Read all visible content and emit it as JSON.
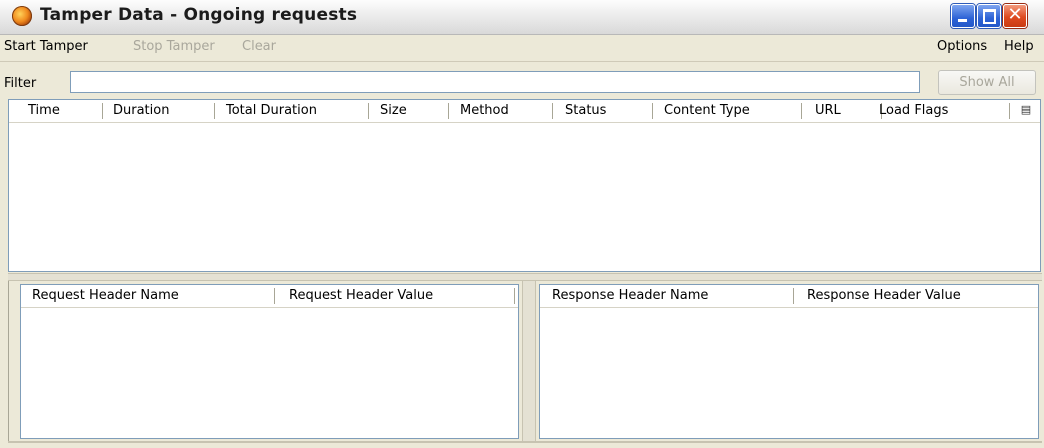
{
  "window": {
    "title": "Tamper Data - Ongoing requests"
  },
  "menubar": {
    "start_tamper": "Start Tamper",
    "stop_tamper": "Stop Tamper",
    "clear": "Clear",
    "options": "Options",
    "help": "Help"
  },
  "filter": {
    "label": "Filter",
    "value": "",
    "show_all": "Show All"
  },
  "requests_table": {
    "columns": [
      "Time",
      "Duration",
      "Total Duration",
      "Size",
      "Method",
      "Status",
      "Content Type",
      "URL",
      "Load Flags"
    ]
  },
  "request_headers_table": {
    "columns": [
      "Request Header Name",
      "Request Header Value"
    ]
  },
  "response_headers_table": {
    "columns": [
      "Response Header Name",
      "Response Header Value"
    ]
  },
  "colors": {
    "titlebar_close": "#df4a20",
    "titlebar_button": "#2d63d6",
    "disabled_text": "#a9a79c",
    "panel_border": "#7f9db9"
  },
  "icons": {
    "app": "firefox-icon",
    "column_picker": "column-picker-icon"
  }
}
